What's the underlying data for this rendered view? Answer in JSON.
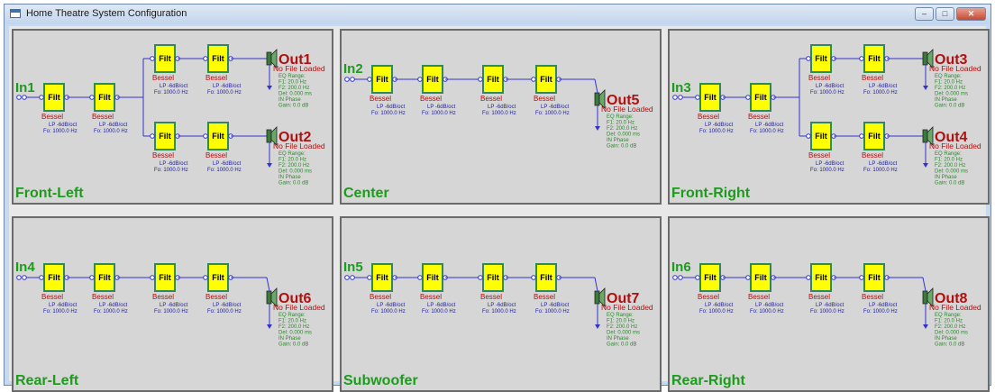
{
  "window": {
    "title": "Home Theatre System Configuration",
    "controls": [
      "minimize",
      "maximize",
      "close"
    ],
    "control_glyphs": [
      "–",
      "□",
      "✕"
    ]
  },
  "colors": {
    "panel_bg": "#d6d6d6",
    "filter_fill": "#ffff00",
    "filter_border": "#2e8b57",
    "wire": "#3333cc",
    "label_green": "#1d9b1d",
    "output_red": "#b01010",
    "bessel_red": "#b01010",
    "text_blue": "#22229a"
  },
  "labels": {
    "filter": "Filt",
    "filter_type": "Bessel",
    "filter_slope": "LP -6dB/oct",
    "filter_freq": "Fo: 1000.0 Hz",
    "no_file": "No File Loaded",
    "output_params": [
      "EQ Range:",
      "F1: 20.0 Hz",
      "F2: 200.0 Hz",
      "Del: 0.000 ms",
      "IN Phase",
      "Gain: 0.0 dB"
    ]
  },
  "panels": [
    {
      "name": "Front-Left",
      "layout": "split",
      "input": "In1",
      "outputs": [
        "Out1",
        "Out2"
      ]
    },
    {
      "name": "Center",
      "layout": "single",
      "input": "In2",
      "outputs": [
        "Out5"
      ]
    },
    {
      "name": "Front-Right",
      "layout": "split",
      "input": "In3",
      "outputs": [
        "Out3",
        "Out4"
      ]
    },
    {
      "name": "Rear-Left",
      "layout": "single",
      "input": "In4",
      "outputs": [
        "Out6"
      ]
    },
    {
      "name": "Subwoofer",
      "layout": "single",
      "input": "In5",
      "outputs": [
        "Out7"
      ]
    },
    {
      "name": "Rear-Right",
      "layout": "single",
      "input": "In6",
      "outputs": [
        "Out8"
      ]
    }
  ]
}
